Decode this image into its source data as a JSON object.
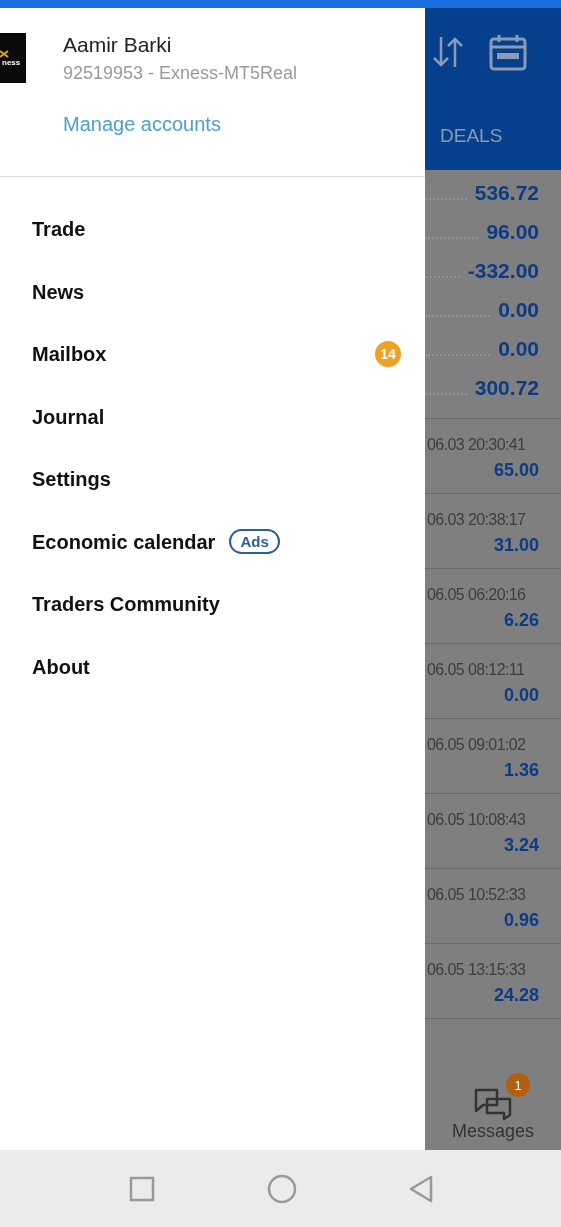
{
  "drawer": {
    "logo_text": "ness",
    "account_name": "Aamir Barki",
    "account_id": "92519953 - Exness-MT5Real",
    "manage_link": "Manage accounts",
    "menu": [
      {
        "label": "Trade"
      },
      {
        "label": "News"
      },
      {
        "label": "Mailbox",
        "badge": "14"
      },
      {
        "label": "Journal"
      },
      {
        "label": "Settings"
      },
      {
        "label": "Economic calendar",
        "tag": "Ads"
      },
      {
        "label": "Traders Community"
      },
      {
        "label": "About"
      }
    ]
  },
  "background_app": {
    "tab": "DEALS",
    "summary_values": [
      "536.72",
      "96.00",
      "-332.00",
      "0.00",
      "0.00",
      "300.72"
    ],
    "deals": [
      {
        "time": "06.03 20:30:41",
        "value": "65.00"
      },
      {
        "time": "06.03 20:38:17",
        "value": "31.00"
      },
      {
        "time": "06.05 06:20:16",
        "value": "6.26"
      },
      {
        "time": "06.05 08:12:11",
        "value": "0.00"
      },
      {
        "time": "06.05 09:01:02",
        "value": "1.36"
      },
      {
        "time": "06.05 10:08:43",
        "value": "3.24"
      },
      {
        "time": "06.05 10:52:33",
        "value": "0.96"
      },
      {
        "time": "06.05 13:15:33",
        "value": "24.28"
      }
    ],
    "messages": {
      "label": "Messages",
      "badge": "1"
    }
  }
}
